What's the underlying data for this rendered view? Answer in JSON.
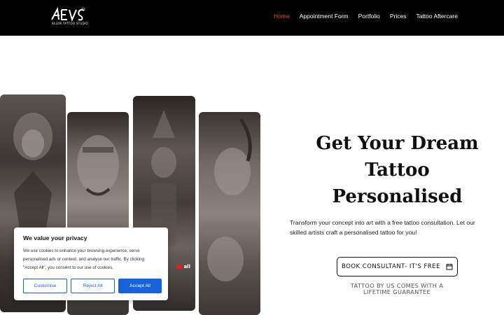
{
  "header": {
    "logo_text": "ALLEN TATTOO STUDIO",
    "nav": [
      {
        "label": "Home",
        "active": true
      },
      {
        "label": "Appointment Form",
        "active": false
      },
      {
        "label": "Portfolio",
        "active": false
      },
      {
        "label": "Prices",
        "active": false
      },
      {
        "label": "Tattoo Aftercare",
        "active": false
      }
    ]
  },
  "hero": {
    "title_line1": "Get Your Dream",
    "title_line2": "Tattoo",
    "title_line3": "Personalised",
    "description": "Transform your concept into art with a free tattoo consultation. Let our skilled artists craft a personalised tattoo for you!",
    "book_button": "BOOK CONSULTANT- IT'S FREE",
    "book_icon": "calendar-icon",
    "guarantee": "TATTOO BY US COMES WITH A LIFETIME GUARANTEE"
  },
  "gallery": {
    "watermark": "all"
  },
  "cookie": {
    "title": "We value your privacy",
    "body": "We use cookies to enhance your browsing experience, serve personalised ads or content, and analyse our traffic. By clicking \"Accept All\", you consent to our use of cookies.",
    "customise": "Customise",
    "reject": "Reject All",
    "accept": "Accept All"
  },
  "colors": {
    "header_bg": "#000000",
    "nav_active": "#e0502c",
    "cookie_accent": "#1863dc"
  }
}
